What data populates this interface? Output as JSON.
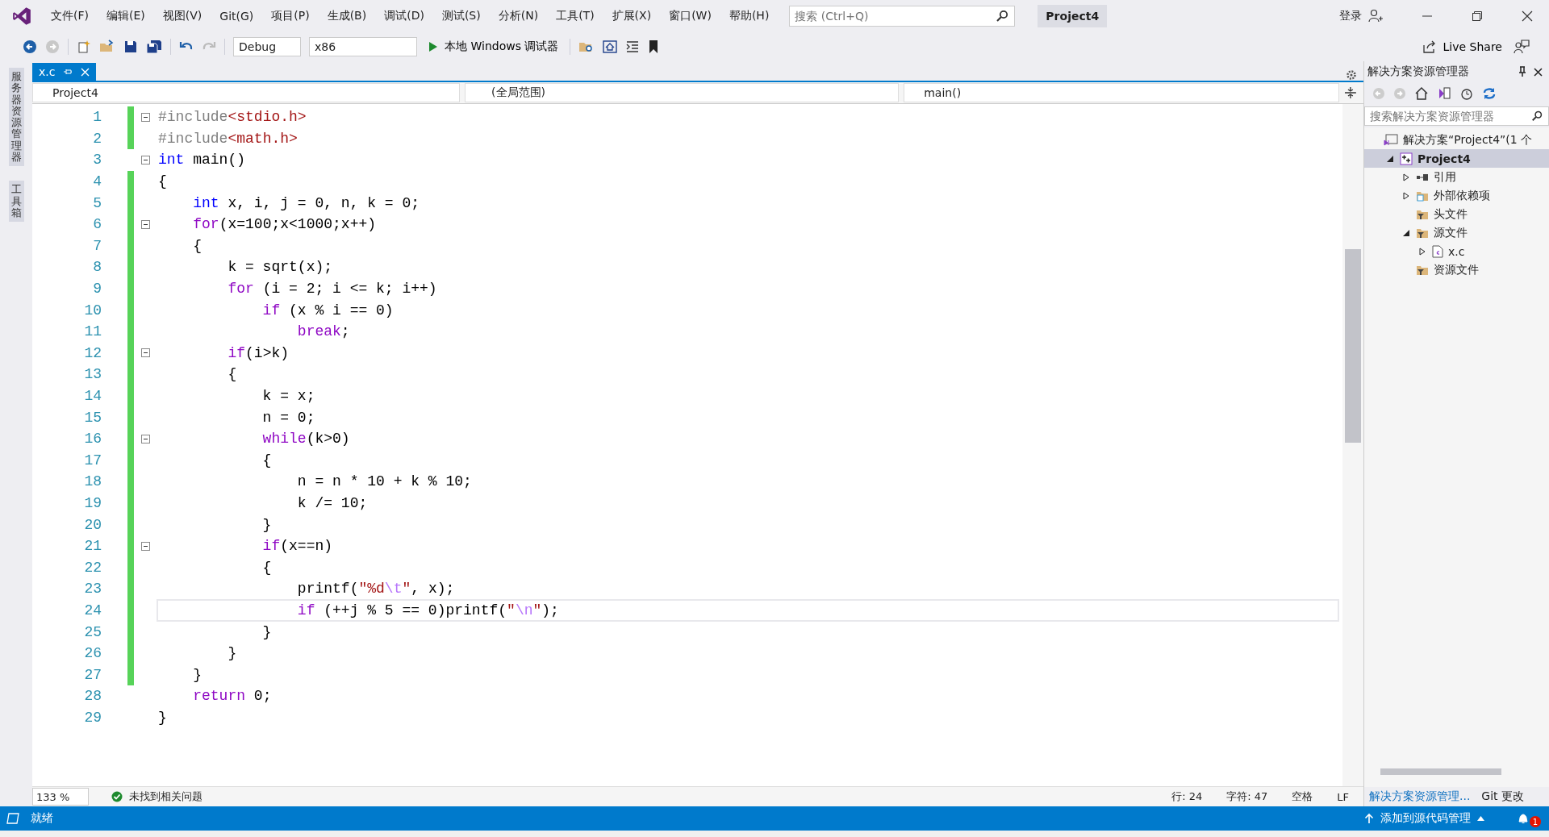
{
  "title_bar": {
    "menus": [
      "文件(F)",
      "编辑(E)",
      "视图(V)",
      "Git(G)",
      "项目(P)",
      "生成(B)",
      "调试(D)",
      "测试(S)",
      "分析(N)",
      "工具(T)",
      "扩展(X)",
      "窗口(W)",
      "帮助(H)"
    ],
    "search": {
      "placeholder": "搜索 (Ctrl+Q)"
    },
    "solution_name": "Project4",
    "login": "登录"
  },
  "toolbar": {
    "configuration": "Debug",
    "platform": "x86",
    "run_label": "本地 Windows 调试器",
    "live_share": "Live Share"
  },
  "side_tabs": [
    "服务器资源管理器",
    "工具箱"
  ],
  "editor": {
    "tabs": [
      {
        "label": "x.c",
        "selected": true
      }
    ],
    "nav": [
      "Project4",
      "(全局范围)",
      "main()"
    ],
    "lines": [
      {
        "number": "1",
        "changed": true,
        "fold": true,
        "current": false,
        "tokens": [
          {
            "kind": "pp",
            "t": "#include"
          },
          {
            "kind": "inc",
            "t": "<stdio.h>"
          }
        ]
      },
      {
        "number": "2",
        "changed": true,
        "fold": false,
        "current": false,
        "tokens": [
          {
            "kind": "pp",
            "t": "#include"
          },
          {
            "kind": "inc",
            "t": "<math.h>"
          }
        ]
      },
      {
        "number": "3",
        "changed": false,
        "fold": true,
        "current": false,
        "tokens": [
          {
            "kind": "kw",
            "t": "int"
          },
          {
            "kind": "p",
            "t": " main()"
          }
        ]
      },
      {
        "number": "4",
        "changed": true,
        "fold": false,
        "current": false,
        "tokens": [
          {
            "kind": "p",
            "t": "{"
          }
        ]
      },
      {
        "number": "5",
        "changed": true,
        "fold": false,
        "current": false,
        "tokens": [
          {
            "kind": "kw",
            "t": "    int"
          },
          {
            "kind": "p",
            "t": " x, i, j = 0, n, k = 0;"
          }
        ]
      },
      {
        "number": "6",
        "changed": true,
        "fold": true,
        "current": false,
        "tokens": [
          {
            "kind": "ctl",
            "t": "    for"
          },
          {
            "kind": "p",
            "t": "(x=100;x<1000;x++)"
          }
        ]
      },
      {
        "number": "7",
        "changed": true,
        "fold": false,
        "current": false,
        "tokens": [
          {
            "kind": "p",
            "t": "    {"
          }
        ]
      },
      {
        "number": "8",
        "changed": true,
        "fold": false,
        "current": false,
        "tokens": [
          {
            "kind": "p",
            "t": "        k = sqrt(x);"
          }
        ]
      },
      {
        "number": "9",
        "changed": true,
        "fold": false,
        "current": false,
        "tokens": [
          {
            "kind": "ctl",
            "t": "        for"
          },
          {
            "kind": "p",
            "t": " (i = 2; i <= k; i++)"
          }
        ]
      },
      {
        "number": "10",
        "changed": true,
        "fold": false,
        "current": false,
        "tokens": [
          {
            "kind": "ctl",
            "t": "            if"
          },
          {
            "kind": "p",
            "t": " (x % i == 0)"
          }
        ]
      },
      {
        "number": "11",
        "changed": true,
        "fold": false,
        "current": false,
        "tokens": [
          {
            "kind": "ctl",
            "t": "                break"
          },
          {
            "kind": "p",
            "t": ";"
          }
        ]
      },
      {
        "number": "12",
        "changed": true,
        "fold": true,
        "current": false,
        "tokens": [
          {
            "kind": "ctl",
            "t": "        if"
          },
          {
            "kind": "p",
            "t": "(i>k)"
          }
        ]
      },
      {
        "number": "13",
        "changed": true,
        "fold": false,
        "current": false,
        "tokens": [
          {
            "kind": "p",
            "t": "        {"
          }
        ]
      },
      {
        "number": "14",
        "changed": true,
        "fold": false,
        "current": false,
        "tokens": [
          {
            "kind": "p",
            "t": "            k = x;"
          }
        ]
      },
      {
        "number": "15",
        "changed": true,
        "fold": false,
        "current": false,
        "tokens": [
          {
            "kind": "p",
            "t": "            n = 0;"
          }
        ]
      },
      {
        "number": "16",
        "changed": true,
        "fold": true,
        "current": false,
        "tokens": [
          {
            "kind": "ctl",
            "t": "            while"
          },
          {
            "kind": "p",
            "t": "(k>0)"
          }
        ]
      },
      {
        "number": "17",
        "changed": true,
        "fold": false,
        "current": false,
        "tokens": [
          {
            "kind": "p",
            "t": "            {"
          }
        ]
      },
      {
        "number": "18",
        "changed": true,
        "fold": false,
        "current": false,
        "tokens": [
          {
            "kind": "p",
            "t": "                n = n * 10 + k % 10;"
          }
        ]
      },
      {
        "number": "19",
        "changed": true,
        "fold": false,
        "current": false,
        "tokens": [
          {
            "kind": "p",
            "t": "                k /= 10;"
          }
        ]
      },
      {
        "number": "20",
        "changed": true,
        "fold": false,
        "current": false,
        "tokens": [
          {
            "kind": "p",
            "t": "            }"
          }
        ]
      },
      {
        "number": "21",
        "changed": true,
        "fold": true,
        "current": false,
        "tokens": [
          {
            "kind": "ctl",
            "t": "            if"
          },
          {
            "kind": "p",
            "t": "(x==n)"
          }
        ]
      },
      {
        "number": "22",
        "changed": true,
        "fold": false,
        "current": false,
        "tokens": [
          {
            "kind": "p",
            "t": "            {"
          }
        ]
      },
      {
        "number": "23",
        "changed": true,
        "fold": false,
        "current": false,
        "tokens": [
          {
            "kind": "p",
            "t": "                printf("
          },
          {
            "kind": "str",
            "t": "\"%d"
          },
          {
            "kind": "esc",
            "t": "\\t"
          },
          {
            "kind": "str",
            "t": "\""
          },
          {
            "kind": "p",
            "t": ", x);"
          }
        ]
      },
      {
        "number": "24",
        "changed": true,
        "fold": false,
        "current": true,
        "tokens": [
          {
            "kind": "ctl",
            "t": "                if"
          },
          {
            "kind": "p",
            "t": " (++j % 5 == 0)printf("
          },
          {
            "kind": "str",
            "t": "\""
          },
          {
            "kind": "esc",
            "t": "\\n"
          },
          {
            "kind": "str",
            "t": "\""
          },
          {
            "kind": "p",
            "t": ");"
          }
        ]
      },
      {
        "number": "25",
        "changed": true,
        "fold": false,
        "current": false,
        "tokens": [
          {
            "kind": "p",
            "t": "            }"
          }
        ]
      },
      {
        "number": "26",
        "changed": true,
        "fold": false,
        "current": false,
        "tokens": [
          {
            "kind": "p",
            "t": "        }"
          }
        ]
      },
      {
        "number": "27",
        "changed": true,
        "fold": false,
        "current": false,
        "tokens": [
          {
            "kind": "p",
            "t": "    }"
          }
        ]
      },
      {
        "number": "28",
        "changed": false,
        "fold": false,
        "current": false,
        "tokens": [
          {
            "kind": "ctl",
            "t": "    return"
          },
          {
            "kind": "p",
            "t": " 0;"
          }
        ]
      },
      {
        "number": "29",
        "changed": false,
        "fold": false,
        "current": false,
        "tokens": [
          {
            "kind": "p",
            "t": "}"
          }
        ]
      }
    ],
    "zoom": "133 %",
    "issues": "未找到相关问题",
    "position": [
      "行: 24",
      "字符: 47",
      "空格",
      "LF"
    ]
  },
  "solution_explorer": {
    "title": "解决方案资源管理器",
    "search": {
      "placeholder": "搜索解决方案资源管理器"
    },
    "tree": [
      {
        "kind": "solution",
        "label": "解决方案“Project4”(1 个",
        "selected": false,
        "children": [
          {
            "kind": "project",
            "label": "Project4",
            "selected": true,
            "expanded": true,
            "children": [
              {
                "kind": "references",
                "label": "引用",
                "selected": false,
                "expanded": false
              },
              {
                "kind": "external",
                "label": "外部依赖项",
                "selected": false,
                "expanded": false
              },
              {
                "kind": "filter",
                "label": "头文件",
                "selected": false
              },
              {
                "kind": "filter",
                "label": "源文件",
                "selected": false,
                "expanded": true,
                "children": [
                  {
                    "kind": "file",
                    "label": "x.c",
                    "selected": false,
                    "expanded": false
                  }
                ]
              },
              {
                "kind": "filter",
                "label": "资源文件",
                "selected": false
              }
            ]
          }
        ]
      }
    ],
    "tabs": [
      {
        "label": "解决方案资源管理...",
        "selected": true
      },
      {
        "label": "Git 更改",
        "selected": false
      }
    ]
  },
  "status_bar": {
    "text": "就绪",
    "source_control": "添加到源代码管理",
    "notifications": "1"
  }
}
